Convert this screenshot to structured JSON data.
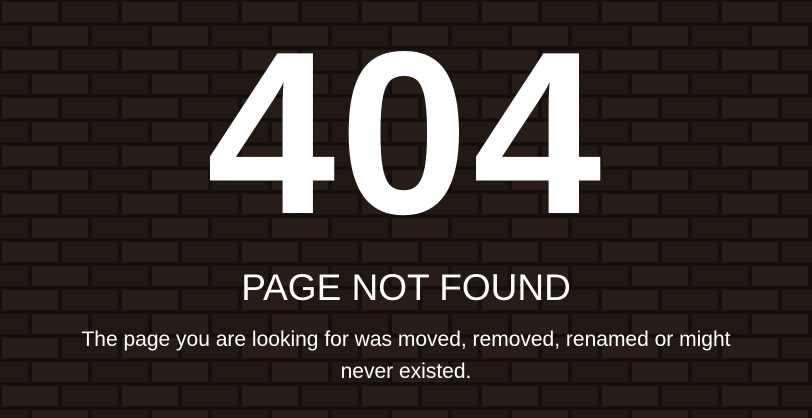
{
  "error": {
    "code": "404",
    "title": "PAGE NOT FOUND",
    "message": "The page you are looking for was moved, removed, renamed or might never existed."
  },
  "colors": {
    "text": "#ffffff",
    "background": "#2b211c",
    "brick": "#3a2a22",
    "mortar": "#221915"
  }
}
